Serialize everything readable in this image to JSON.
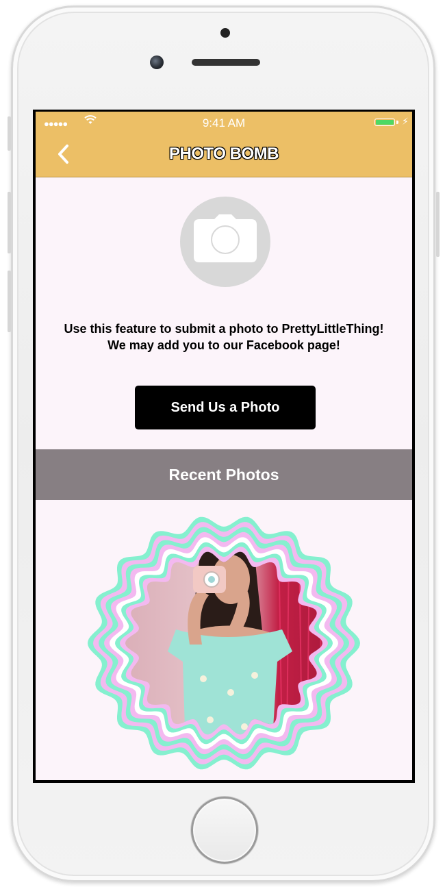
{
  "status_bar": {
    "signal": "●●●●●",
    "time": "9:41 AM",
    "battery_level": 1.0,
    "battery_color": "#4cd964"
  },
  "nav": {
    "title": "PHOTO BOMB",
    "back_icon": "chevron-left-icon",
    "bar_color": "#ecbf66"
  },
  "main": {
    "camera_icon": "camera-icon",
    "description_line1": "Use this feature to submit a photo to PrettyLittleThing!",
    "description_line2": "We may add you to our Facebook page!",
    "send_button_label": "Send Us a Photo"
  },
  "recent": {
    "header": "Recent Photos",
    "header_color": "#877f83",
    "photos": [
      {
        "frame": "scalloped-pastel-frame"
      }
    ]
  }
}
